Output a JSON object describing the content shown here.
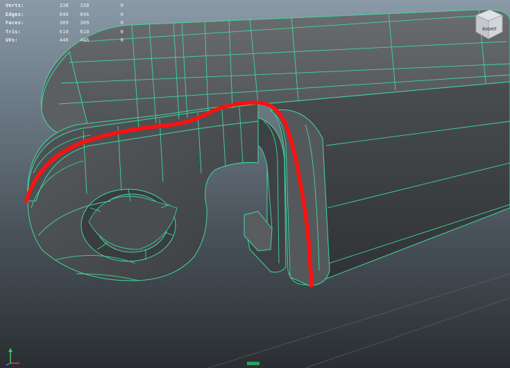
{
  "viewport": {
    "panel_name": "3D viewport",
    "background_top": "#8a9aa6",
    "background_bottom": "#2a2e32"
  },
  "hud": {
    "rows": [
      {
        "label": "Verts:",
        "v1": "338",
        "v2": "338",
        "v3": "0"
      },
      {
        "label": "Edges:",
        "v1": "646",
        "v2": "646",
        "v3": "0"
      },
      {
        "label": "Faces:",
        "v1": "309",
        "v2": "309",
        "v3": "0"
      },
      {
        "label": "Tris:",
        "v1": "610",
        "v2": "610",
        "v3": "0"
      },
      {
        "label": "UVs:",
        "v1": "446",
        "v2": "446",
        "v3": "0"
      }
    ]
  },
  "view_cube": {
    "face_label": "RIGHT",
    "icon": "view-cube-icon"
  },
  "axis_gizmo": {
    "icon": "axis-gizmo-icon"
  },
  "model": {
    "wire_color": "#3fd9a0",
    "surface_color": "#4a4c4e",
    "annotation_color": "#ff1010"
  }
}
